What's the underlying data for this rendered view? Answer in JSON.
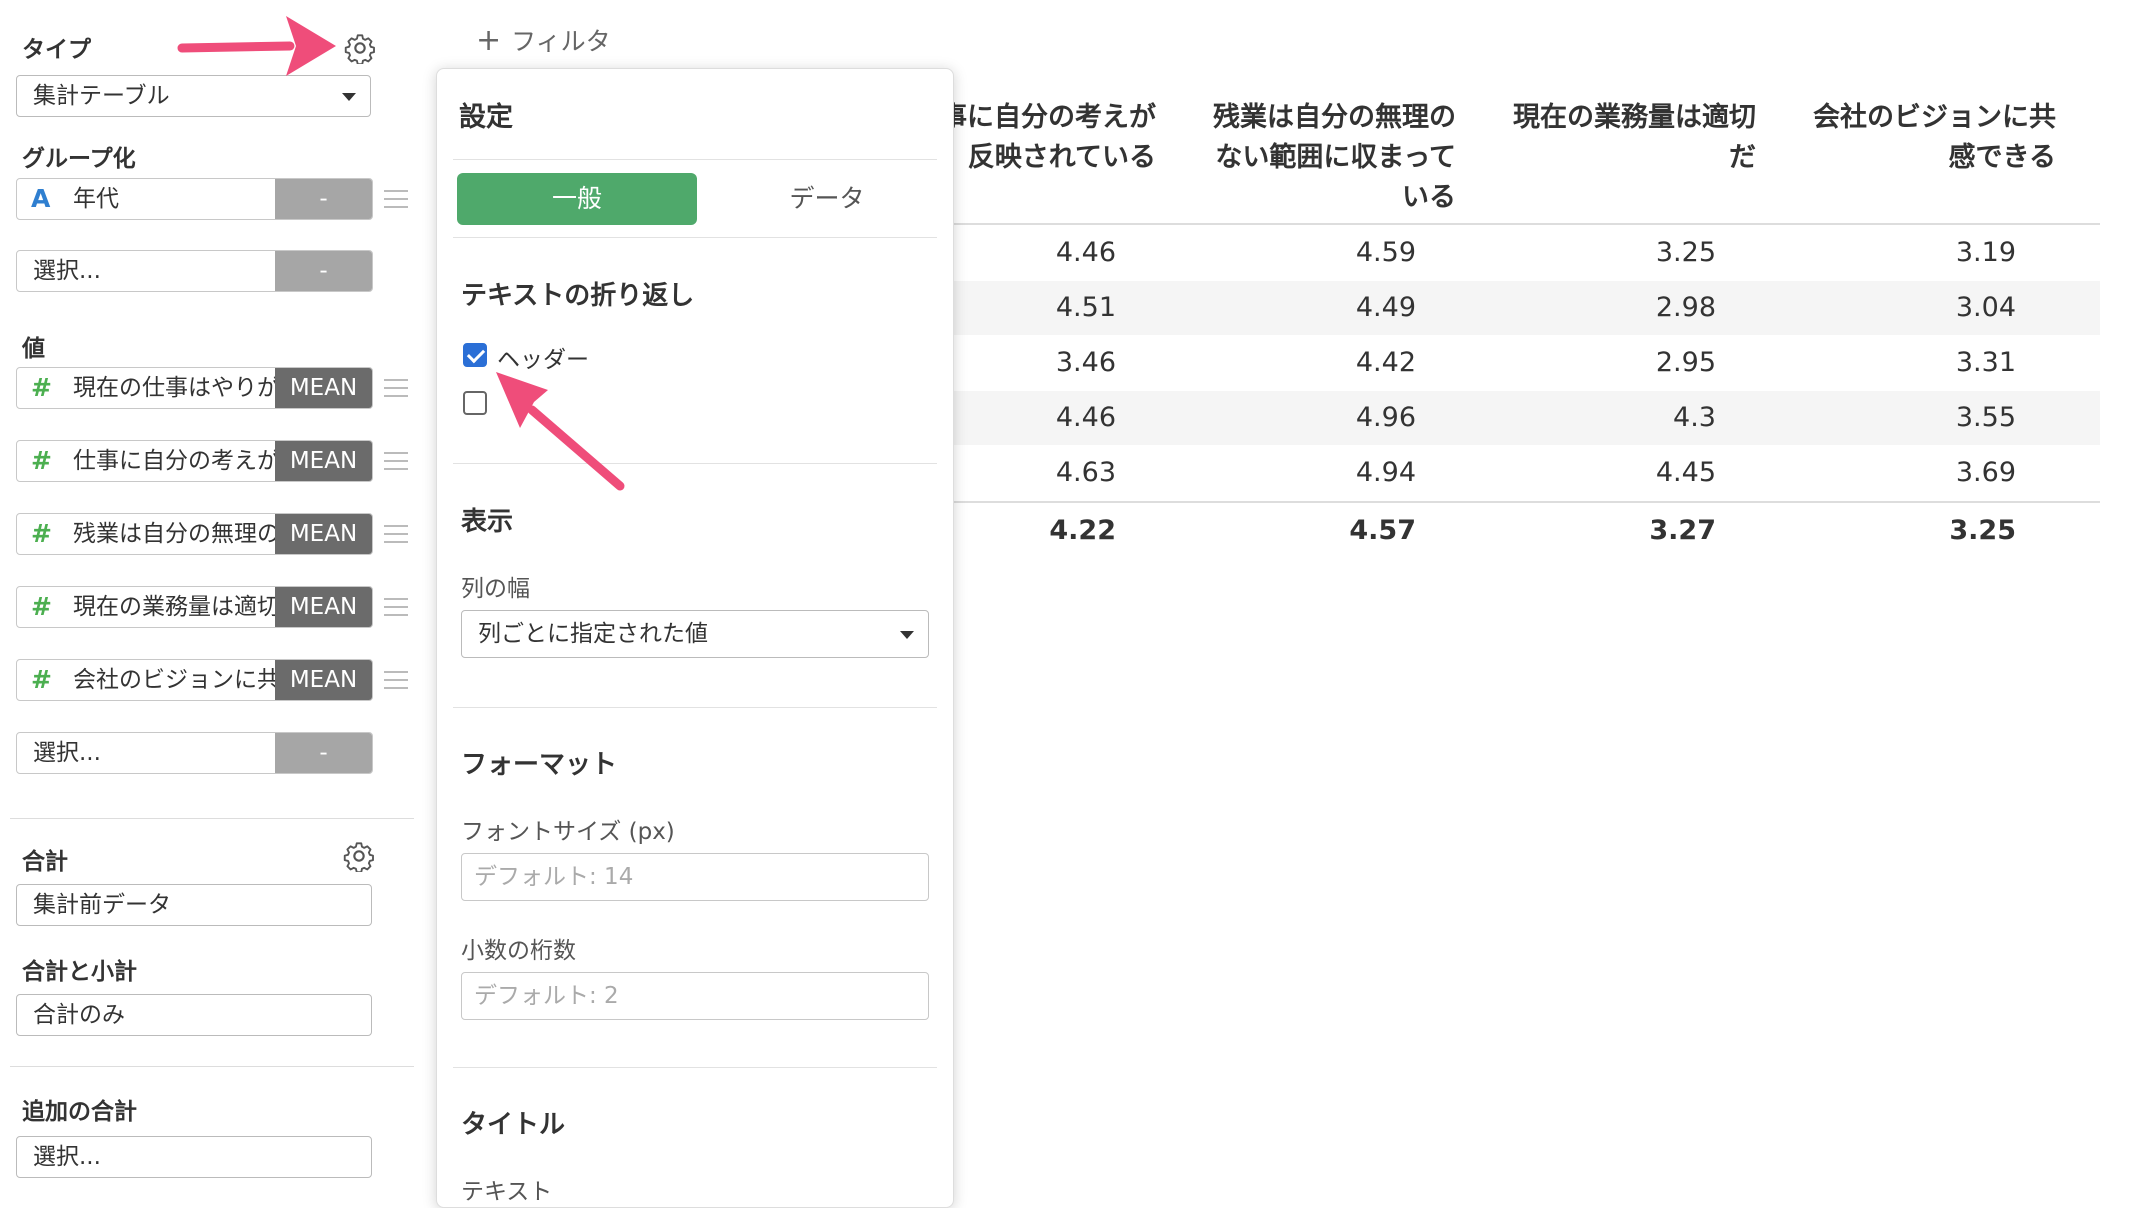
{
  "sidebar": {
    "type_label": "タイプ",
    "type_value": "集計テーブル",
    "group_label": "グループ化",
    "group_items": [
      {
        "name": "年代",
        "agg": "-"
      },
      {
        "name": "選択...",
        "agg": "-"
      }
    ],
    "value_label": "値",
    "value_items": [
      {
        "name": "現在の仕事はやりがいを感じる",
        "agg": "MEAN"
      },
      {
        "name": "仕事に自分の考えが反映されている",
        "agg": "MEAN"
      },
      {
        "name": "残業は自分の無理のない範囲に収まっている",
        "agg": "MEAN"
      },
      {
        "name": "現在の業務量は適切だ",
        "agg": "MEAN"
      },
      {
        "name": "会社のビジョンに共感できる",
        "agg": "MEAN"
      },
      {
        "name": "選択...",
        "agg": "-"
      }
    ],
    "total_label": "合計",
    "total_value": "集計前データ",
    "subtotal_label": "合計と小計",
    "subtotal_value": "合計のみ",
    "extra_total_label": "追加の合計",
    "extra_total_value": "選択..."
  },
  "filter": {
    "label": "フィルタ"
  },
  "table": {
    "headers": [
      [
        "事に自分の考えが",
        "反映されている"
      ],
      [
        "残業は自分の無理の",
        "ない範囲に収まって",
        "いる"
      ],
      [
        "現在の業務量は適切",
        "だ"
      ],
      [
        "会社のビジョンに共",
        "感できる"
      ]
    ],
    "rows": [
      [
        "4.46",
        "4.59",
        "3.25",
        "3.19"
      ],
      [
        "4.51",
        "4.49",
        "2.98",
        "3.04"
      ],
      [
        "3.46",
        "4.42",
        "2.95",
        "3.31"
      ],
      [
        "4.46",
        "4.96",
        "4.3",
        "3.55"
      ],
      [
        "4.63",
        "4.94",
        "4.45",
        "3.69"
      ]
    ],
    "total": [
      "4.22",
      "4.57",
      "3.27",
      "3.25"
    ]
  },
  "popup": {
    "title": "設定",
    "tab_general": "一般",
    "tab_data": "データ",
    "wrap_section": "テキストの折り返し",
    "wrap_header_label": "ヘッダー",
    "wrap_header_checked": true,
    "display_section": "表示",
    "col_width_label": "列の幅",
    "col_width_value": "列ごとに指定された値",
    "format_section": "フォーマット",
    "font_size_label": "フォントサイズ (px)",
    "font_size_placeholder": "デフォルト: 14",
    "decimals_label": "小数の桁数",
    "decimals_placeholder": "デフォルト: 2",
    "title_section": "タイトル",
    "text_label": "テキスト"
  },
  "colors": {
    "accent_green": "#4fa96b",
    "arrow_pink": "#ef4d7a",
    "checkbox_blue": "#2b6fd6"
  }
}
